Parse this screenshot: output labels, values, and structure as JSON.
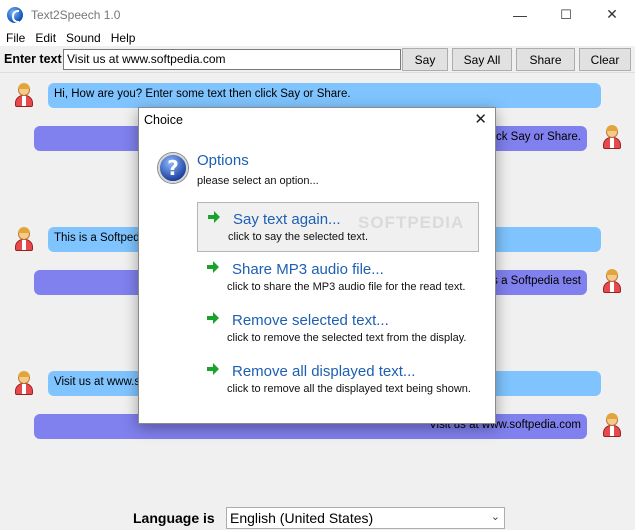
{
  "window": {
    "title": "Text2Speech 1.0",
    "minimize": "—",
    "maximize": "☐",
    "close": "✕"
  },
  "menu": [
    "File",
    "Edit",
    "Sound",
    "Help"
  ],
  "toolbar": {
    "enter_label": "Enter text",
    "input_value": "Visit us at www.softpedia.com",
    "say": "Say",
    "say_all": "Say All",
    "share": "Share",
    "clear": "Clear"
  },
  "chat": [
    {
      "side": "left",
      "text": "Hi, How are you? Enter some text then click Say or Share."
    },
    {
      "side": "right",
      "text": "ick Say or Share."
    },
    {
      "side": "left",
      "text": "This is a Softpedia"
    },
    {
      "side": "right",
      "text": "s a Softpedia test"
    },
    {
      "side": "left",
      "text": "Visit us at www.so"
    },
    {
      "side": "right",
      "text": "Visit us at www.softpedia.com"
    }
  ],
  "bottom": {
    "language_label": "Language is",
    "language_value": "English (United States)",
    "dropdown_arrow": "⌄"
  },
  "dialog": {
    "title": "Choice",
    "close": "✕",
    "heading": "Options",
    "subheading": "please select an option...",
    "watermark": "SOFTPEDIA",
    "options": [
      {
        "label": "Say text again...",
        "desc": "click to say the selected text."
      },
      {
        "label": "Share MP3 audio file...",
        "desc": "click to share the MP3 audio file for the read text."
      },
      {
        "label": "Remove selected text...",
        "desc": "click to remove the selected text from the display."
      },
      {
        "label": "Remove all displayed text...",
        "desc": "click to remove all the displayed text being shown."
      }
    ]
  },
  "colors": {
    "left_bubble": "#7fc4ff",
    "right_bubble": "#8080ee",
    "accent_blue": "#1c5fb3",
    "arrow_green": "#1aa32a"
  }
}
